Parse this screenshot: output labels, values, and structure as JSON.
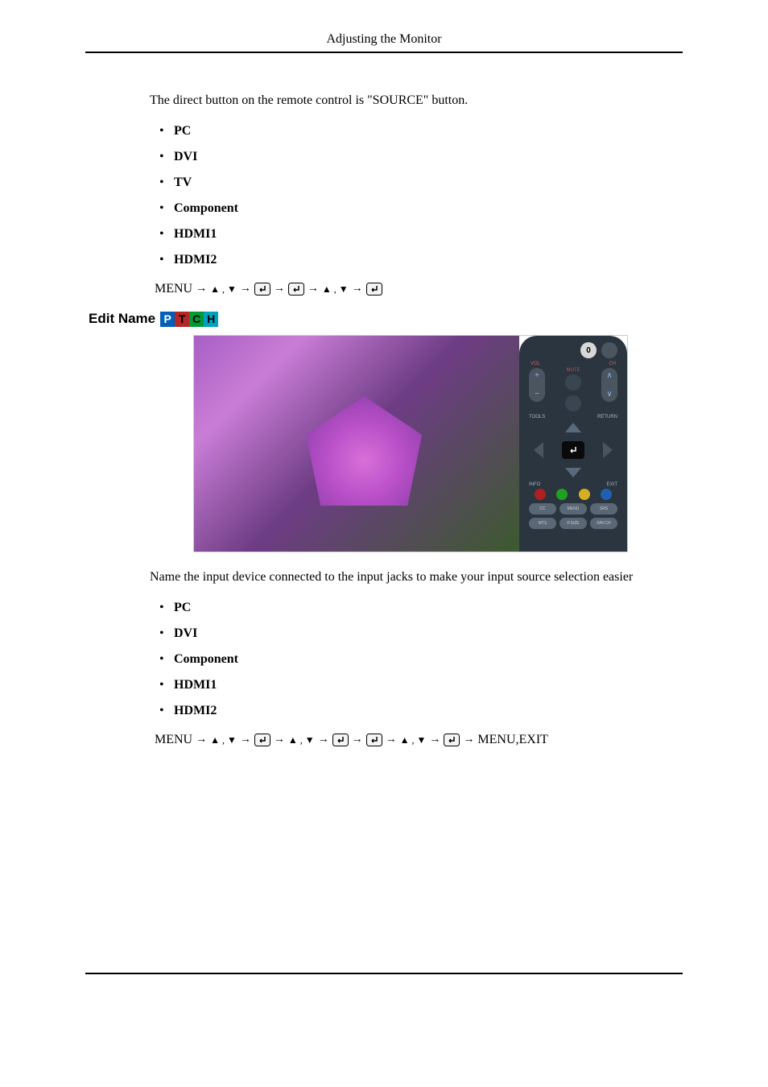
{
  "header": {
    "title": "Adjusting the Monitor"
  },
  "section_source": {
    "intro": "The direct button on the remote control is \"SOURCE\" button.",
    "items": [
      "PC",
      "DVI",
      "TV",
      "Component",
      "HDMI1",
      "HDMI2"
    ],
    "menu_path": {
      "start": "MENU"
    }
  },
  "section_edit": {
    "heading": "Edit Name",
    "badges": [
      "P",
      "T",
      "C",
      "H"
    ],
    "intro": "Name the input device connected to the input jacks to make your input source selection easier",
    "items": [
      "PC",
      "DVI",
      "Component",
      "HDMI1",
      "HDMI2"
    ],
    "menu_path": {
      "start": "MENU",
      "end": "MENU,EXIT"
    }
  },
  "remote": {
    "zero": "0",
    "vol": "VOL",
    "ch": "CH",
    "mute": "MUTE",
    "tools": "TOOLS",
    "return": "RETURN",
    "info": "INFO",
    "exit": "EXIT",
    "cc": "CC",
    "menu": "MENU",
    "srs": "SRS",
    "mts": "MTS",
    "psize": "P.SIZE",
    "favch": "FAV.CH"
  }
}
